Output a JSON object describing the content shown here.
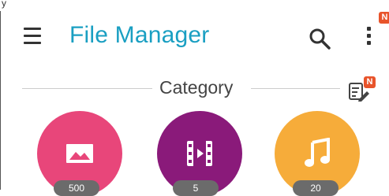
{
  "app": {
    "title": "File Manager"
  },
  "toolbar": {
    "menu_icon": "hamburger-menu-icon",
    "search_icon": "search-icon",
    "more_icon": "more-vertical-icon",
    "notification_badge": "N"
  },
  "section": {
    "label": "Category",
    "edit_icon": "edit-list-icon",
    "edit_badge": "N"
  },
  "categories": [
    {
      "name": "Images",
      "icon": "image-icon",
      "color": "#e8467a",
      "count": "500"
    },
    {
      "name": "Videos",
      "icon": "film-icon",
      "color": "#8a1a7a",
      "count": "5"
    },
    {
      "name": "Music",
      "icon": "music-note-icon",
      "color": "#f6ac3a",
      "count": "20"
    }
  ],
  "colors": {
    "accent": "#1a9fc2",
    "badge": "#e8542b"
  }
}
